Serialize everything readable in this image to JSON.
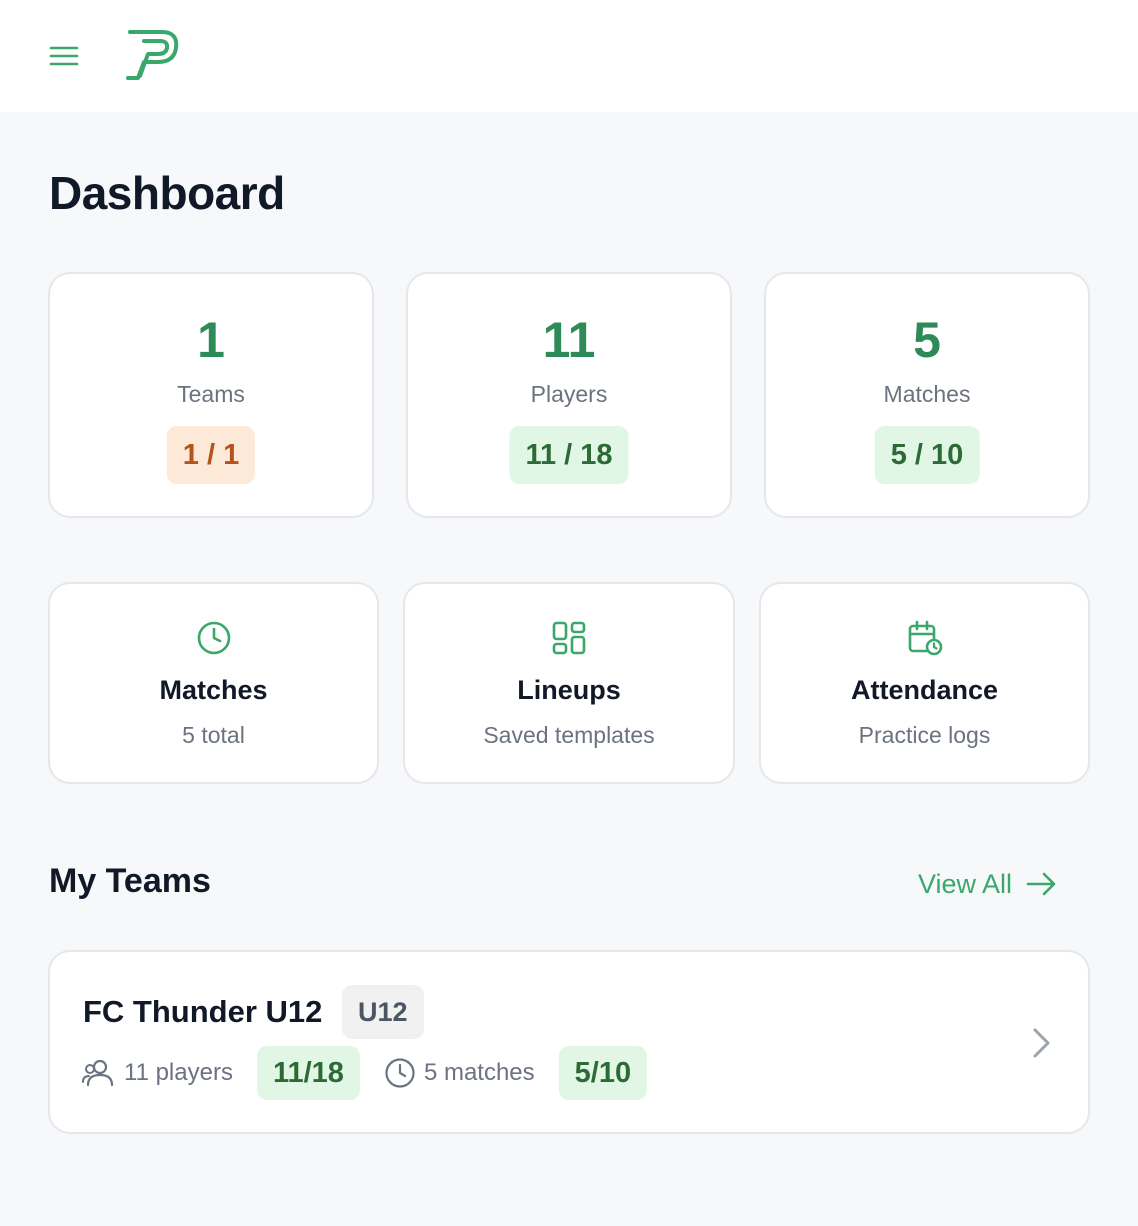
{
  "header": {
    "menu_icon": "hamburger-menu-icon",
    "logo_icon": "p-logo-icon"
  },
  "page": {
    "title": "Dashboard"
  },
  "stats": [
    {
      "value": "1",
      "label": "Teams",
      "badge": "1 / 1",
      "badge_color": "#fde9d8"
    },
    {
      "value": "11",
      "label": "Players",
      "badge": "11 / 18",
      "badge_color": "#e1f6e5"
    },
    {
      "value": "5",
      "label": "Matches",
      "badge": "5 / 10",
      "badge_color": "#e1f6e5"
    }
  ],
  "nav_cards": [
    {
      "icon": "clock-icon",
      "title": "Matches",
      "subtitle": "5 total"
    },
    {
      "icon": "grid-layout-icon",
      "title": "Lineups",
      "subtitle": "Saved templates"
    },
    {
      "icon": "calendar-clock-icon",
      "title": "Attendance",
      "subtitle": "Practice logs"
    }
  ],
  "teams_section": {
    "title": "My Teams",
    "view_all": "View All",
    "teams": [
      {
        "name": "FC Thunder U12",
        "age_group": "U12",
        "players": "11 players",
        "players_badge": "11/18",
        "matches": "5 matches",
        "matches_badge": "5/10"
      }
    ]
  },
  "colors": {
    "accent": "#3aa86b",
    "stat_value": "#2e8b57",
    "warning_badge_bg": "#fde9d8",
    "success_badge_bg": "#e1f6e5"
  }
}
